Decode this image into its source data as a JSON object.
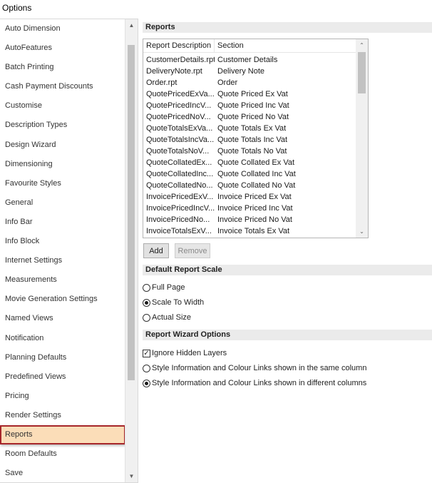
{
  "window": {
    "title": "Options"
  },
  "categories": [
    "Auto Dimension",
    "AutoFeatures",
    "Batch Printing",
    "Cash Payment Discounts",
    "Customise",
    "Description Types",
    "Design Wizard",
    "Dimensioning",
    "Favourite Styles",
    "General",
    "Info Bar",
    "Info Block",
    "Internet Settings",
    "Measurements",
    "Movie Generation Settings",
    "Named Views",
    "Notification",
    "Planning Defaults",
    "Predefined Views",
    "Pricing",
    "Render Settings",
    "Reports",
    "Room Defaults",
    "Save"
  ],
  "selected_category": "Reports",
  "reports_section": {
    "title": "Reports",
    "columns": [
      "Report Description",
      "Section"
    ],
    "rows": [
      [
        "CustomerDetails.rpt",
        "Customer Details"
      ],
      [
        "DeliveryNote.rpt",
        "Delivery Note"
      ],
      [
        "Order.rpt",
        "Order"
      ],
      [
        "QuotePricedExVa...",
        "Quote Priced Ex Vat"
      ],
      [
        "QuotePricedIncV...",
        "Quote Priced Inc Vat"
      ],
      [
        "QuotePricedNoV...",
        "Quote Priced No Vat"
      ],
      [
        "QuoteTotalsExVa...",
        "Quote Totals Ex Vat"
      ],
      [
        "QuoteTotalsIncVa...",
        "Quote Totals Inc Vat"
      ],
      [
        "QuoteTotalsNoV...",
        "Quote Totals No Vat"
      ],
      [
        "QuoteCollatedEx...",
        "Quote Collated Ex Vat"
      ],
      [
        "QuoteCollatedInc...",
        "Quote Collated Inc Vat"
      ],
      [
        "QuoteCollatedNo...",
        "Quote Collated No Vat"
      ],
      [
        "InvoicePricedExV...",
        "Invoice Priced Ex Vat"
      ],
      [
        "InvoicePricedIncV...",
        "Invoice Priced Inc Vat"
      ],
      [
        "InvoicePricedNo...",
        "Invoice Priced No Vat"
      ],
      [
        "InvoiceTotalsExV...",
        "Invoice Totals Ex Vat"
      ]
    ],
    "add_label": "Add",
    "remove_label": "Remove"
  },
  "scale_section": {
    "title": "Default Report Scale",
    "options": [
      {
        "label": "Full Page",
        "selected": false
      },
      {
        "label": "Scale To Width",
        "selected": true
      },
      {
        "label": "Actual Size",
        "selected": false
      }
    ]
  },
  "wizard_section": {
    "title": "Report Wizard Options",
    "ignore_hidden_layers": {
      "label": "Ignore Hidden Layers",
      "checked": true
    },
    "options": [
      {
        "label": "Style Information and Colour Links shown in the same column",
        "selected": false
      },
      {
        "label": "Style Information and Colour Links shown in different columns",
        "selected": true
      }
    ]
  },
  "icons": {
    "scroll_up": "arrow-up-icon",
    "scroll_down": "arrow-down-icon",
    "check": "checkmark-icon"
  },
  "colors": {
    "selection_fill": "#fbddb8",
    "selection_border": "#a6262a",
    "section_header": "#ebebeb"
  }
}
